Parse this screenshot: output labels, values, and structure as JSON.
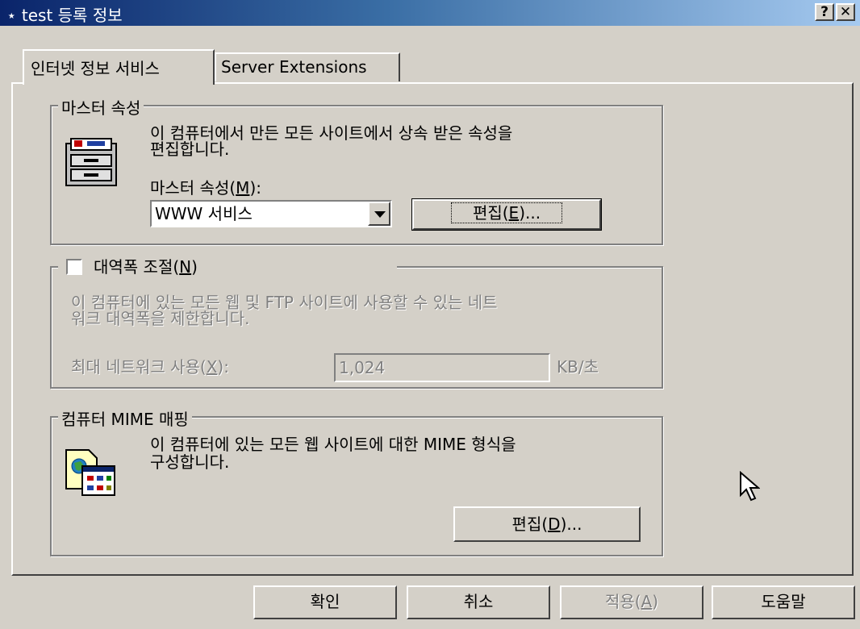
{
  "window": {
    "title": "test 등록 정보",
    "help_label": "?",
    "close_label": "✕"
  },
  "tabs": [
    {
      "label": "인터넷 정보 서비스"
    },
    {
      "label": "Server Extensions"
    }
  ],
  "master": {
    "legend": "마스터 속성",
    "description_line1": "이 컴퓨터에서 만든 모든 사이트에서 상속 받은 속성을",
    "description_line2": "편집합니다.",
    "label_prefix": "마스터 속성(",
    "label_key": "M",
    "label_suffix": "):",
    "select_value": "WWW 서비스",
    "edit_prefix": "편집(",
    "edit_key": "E",
    "edit_suffix": ")..."
  },
  "bandwidth": {
    "checkbox_prefix": "대역폭 조절(",
    "checkbox_key": "N",
    "checkbox_suffix": ")",
    "checked": false,
    "description_line1": "이 컴퓨터에 있는 모든 웹 및 FTP 사이트에 사용할 수 있는 네트",
    "description_line2": "워크 대역폭을 제한합니다.",
    "max_prefix": "최대 네트워크 사용(",
    "max_key": "X",
    "max_suffix": "):",
    "max_value": "1,024",
    "unit": "KB/초"
  },
  "mime": {
    "legend": "컴퓨터 MIME 매핑",
    "description_line1": "이 컴퓨터에 있는 모든 웹 사이트에 대한 MIME 형식을",
    "description_line2": "구성합니다.",
    "edit_prefix": "편집(",
    "edit_key": "D",
    "edit_suffix": ")..."
  },
  "footer": {
    "ok": "확인",
    "cancel": "취소",
    "apply_prefix": "적용(",
    "apply_key": "A",
    "apply_suffix": ")",
    "help": "도움말"
  }
}
